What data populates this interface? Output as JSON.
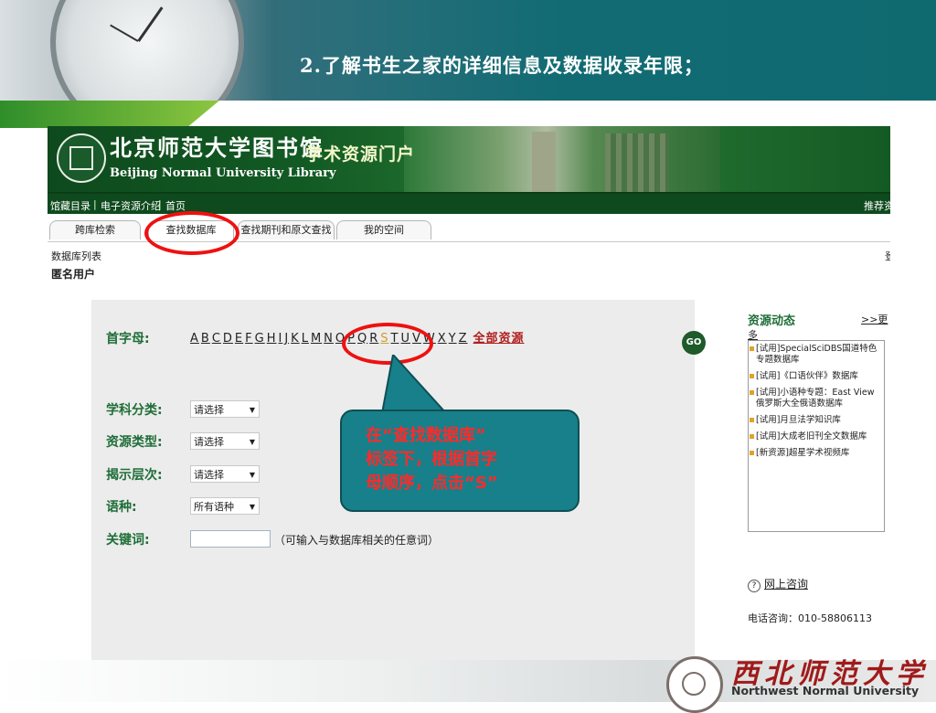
{
  "slide": {
    "title": "2.了解书生之家的详细信息及数据收录年限；"
  },
  "site": {
    "library_name_cn": "北京师范大学图书馆",
    "library_name_en": "Beijing Normal University Library",
    "portal_name": "学术资源门户",
    "nav_items": [
      "馆藏目录",
      "电子资源介绍",
      "首页"
    ],
    "nav_right": "推荐资",
    "tabs": [
      "跨库检索",
      "查找数据库",
      "查找期刊和原文查找",
      "我的空间"
    ],
    "active_tab": "查找数据库",
    "breadcrumb": "数据库列表",
    "breadcrumb_right": "登",
    "user_label": "匿名用户"
  },
  "search_form": {
    "initial_label": "首字母:",
    "letters": [
      "A",
      "B",
      "C",
      "D",
      "E",
      "F",
      "G",
      "H",
      "I",
      "J",
      "K",
      "L",
      "M",
      "N",
      "O",
      "P",
      "Q",
      "R",
      "S",
      "T",
      "U",
      "V",
      "W",
      "X",
      "Y",
      "Z"
    ],
    "highlighted_letter": "S",
    "all_resources_link": "全部资源",
    "fields": [
      {
        "label": "学科分类:",
        "value": "请选择"
      },
      {
        "label": "资源类型:",
        "value": "请选择"
      },
      {
        "label": "揭示层次:",
        "value": "请选择"
      },
      {
        "label": "语种:",
        "value": "所有语种"
      }
    ],
    "keyword_label": "关键词:",
    "keyword_value": "",
    "keyword_hint": "（可输入与数据库相关的任意词）",
    "go_label": "GO"
  },
  "sidebar": {
    "title": "资源动态",
    "more_link_a": ">>更",
    "more_link_b": "多",
    "news": [
      "[试用]SpecialSciDBS国道特色专题数据库",
      "[试用]《口语伙伴》数据库",
      "[试用]小语种专题：East View俄罗斯大全俄语数据库",
      "[试用]月旦法学知识库",
      "[试用]大成老旧刊全文数据库",
      "[新资源]超星学术视频库"
    ],
    "consult_link": "网上咨询",
    "phone": "电话咨询：010-58806113"
  },
  "annotation": {
    "lines": [
      "在“查找数据库”",
      "标签下，根据首字",
      "母顺序，点击“S”"
    ]
  },
  "footer": {
    "university_cn": "西北师范大学",
    "university_en": "Northwest Normal University"
  },
  "colors": {
    "header_teal": "#126b73",
    "library_green": "#0e4a1d",
    "label_green": "#1f6e38",
    "callout_teal": "#17808a",
    "callout_text_red": "#ff2a2a",
    "highlight_red": "#e11111",
    "highlight_letter": "#d39a2e"
  }
}
